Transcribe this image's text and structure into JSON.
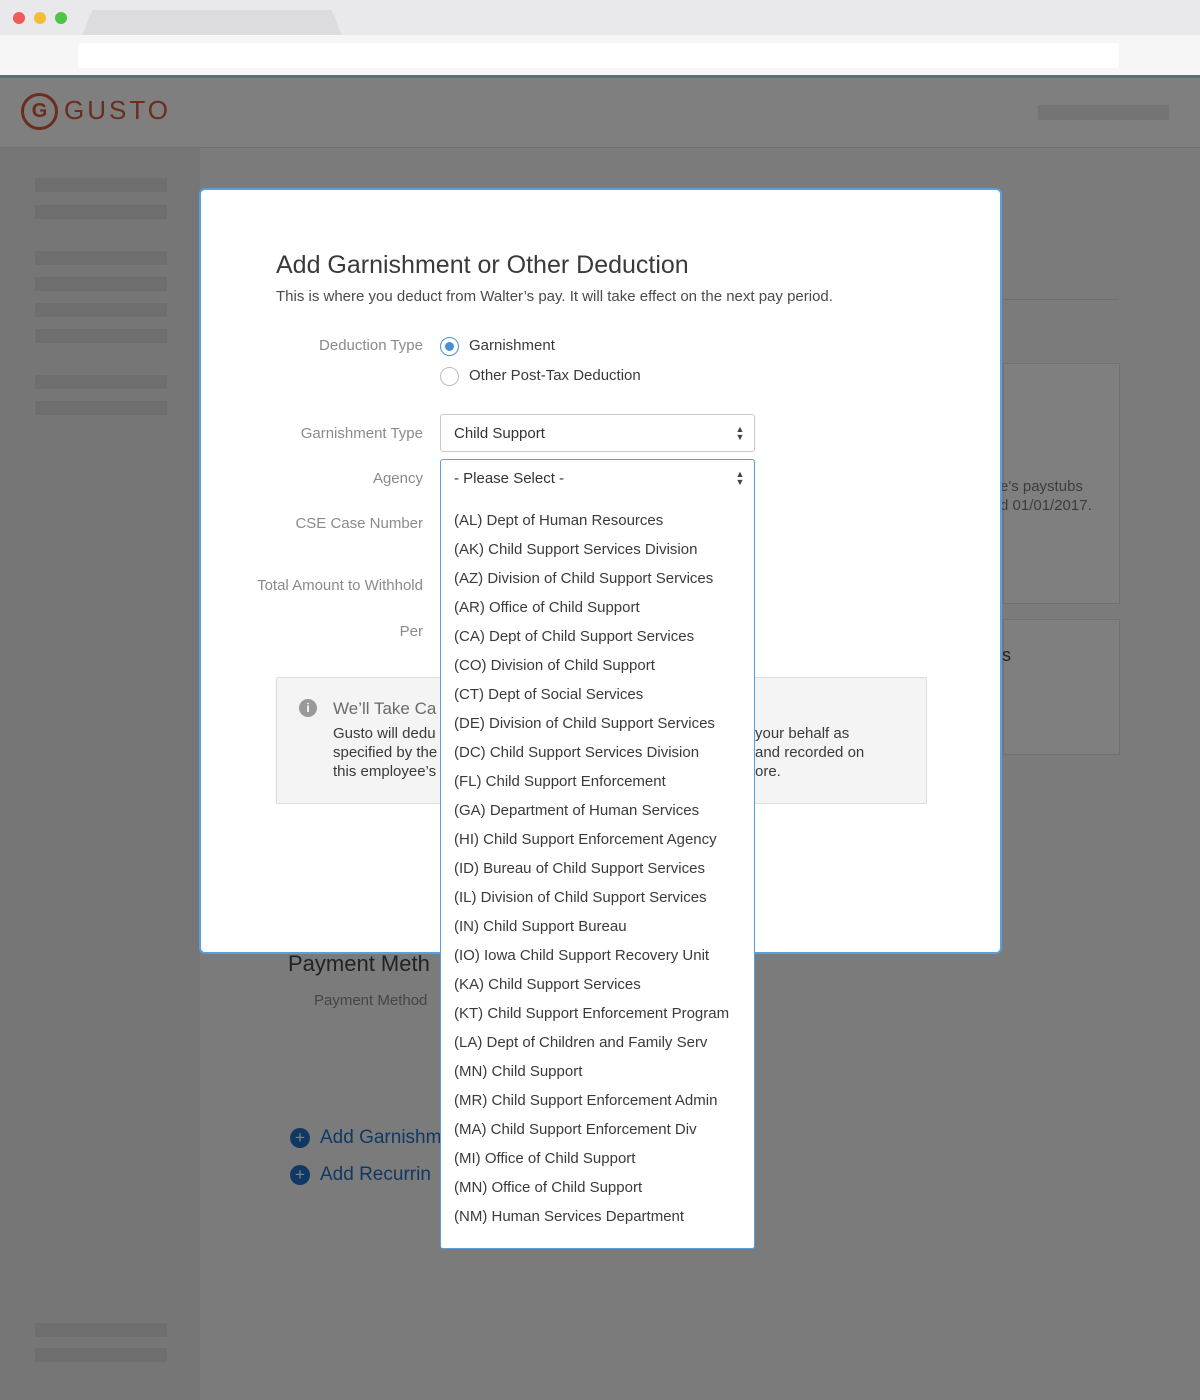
{
  "app": {
    "logo_mark": "G",
    "logo_text": "GUSTO"
  },
  "background": {
    "partial_text_1": "e's paystubs",
    "partial_text_2": "d 01/01/2017.",
    "partial_text_3": "s",
    "payment_heading": "Payment Meth",
    "payment_label": "Payment Method",
    "link_garnishment": "Add Garnishm",
    "link_recurring": "Add Recurrin"
  },
  "modal": {
    "title": "Add Garnishment or Other Deduction",
    "subtitle": "This is where you deduct from Walter’s pay. It will take effect on the next pay period.",
    "labels": {
      "deduction_type": "Deduction Type",
      "garnishment_type": "Garnishment Type",
      "agency": "Agency",
      "case_number": "CSE Case Number",
      "total_amount": "Total Amount to Withhold",
      "per": "Per"
    },
    "deduction_options": [
      {
        "label": "Garnishment",
        "checked": true
      },
      {
        "label": "Other Post-Tax Deduction",
        "checked": false
      }
    ],
    "garnishment_type_value": "Child Support",
    "agency_value": "- Please Select -",
    "info": {
      "title": "We’ll Take Ca",
      "line1_left": "Gusto will dedu",
      "line1_right": "your behalf as",
      "line2_left": "specified by the",
      "line2_right": "and recorded on",
      "line3_left": "this employee’s",
      "line3_right": "ore."
    }
  },
  "agency_options": [
    "(AL) Dept of Human Resources",
    "(AK) Child Support Services Division",
    "(AZ) Division of Child Support Services",
    "(AR) Office of Child Support",
    "(CA) Dept of Child Support Services",
    "(CO) Division of Child Support",
    "(CT) Dept of Social Services",
    "(DE) Division of Child Support Services",
    "(DC) Child Support Services Division",
    "(FL) Child Support Enforcement",
    "(GA) Department of Human Services",
    "(HI) Child Support Enforcement Agency",
    "(ID) Bureau of Child Support Services",
    "(IL) Division of Child Support Services",
    "(IN) Child Support Bureau",
    "(IO) Iowa Child Support Recovery Unit",
    "(KA) Child Support Services",
    "(KT) Child Support Enforcement Program",
    "(LA) Dept of Children and Family Serv",
    "(MN) Child Support",
    "(MR) Child Support Enforcement Admin",
    "(MA) Child Support Enforcement Div",
    "(MI) Office of Child Support",
    "(MN) Office of Child Support",
    "(NM) Human Services Department"
  ],
  "icons": {
    "info": "i",
    "plus": "+",
    "select_arrow_up": "▲",
    "select_arrow_down": "▼"
  },
  "colors": {
    "brand": "#d45a3d",
    "accent": "#4a90d9",
    "link": "#1f72c9"
  }
}
